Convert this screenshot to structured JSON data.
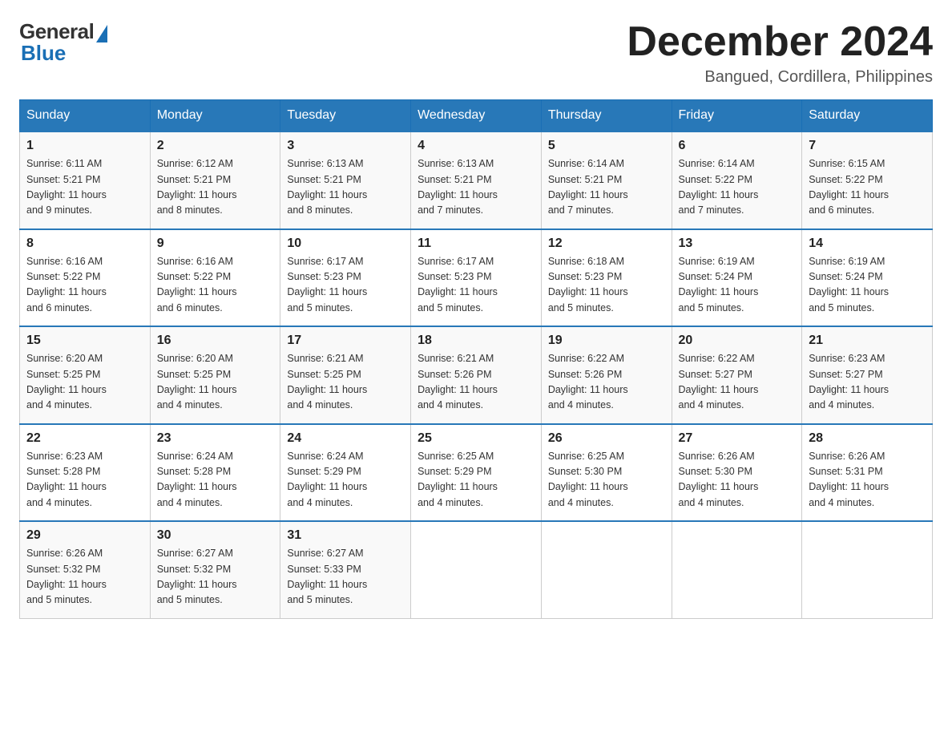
{
  "header": {
    "logo_general": "General",
    "logo_blue": "Blue",
    "month_title": "December 2024",
    "location": "Bangued, Cordillera, Philippines"
  },
  "weekdays": [
    "Sunday",
    "Monday",
    "Tuesday",
    "Wednesday",
    "Thursday",
    "Friday",
    "Saturday"
  ],
  "weeks": [
    [
      {
        "day": "1",
        "sunrise": "6:11 AM",
        "sunset": "5:21 PM",
        "daylight": "11 hours and 9 minutes."
      },
      {
        "day": "2",
        "sunrise": "6:12 AM",
        "sunset": "5:21 PM",
        "daylight": "11 hours and 8 minutes."
      },
      {
        "day": "3",
        "sunrise": "6:13 AM",
        "sunset": "5:21 PM",
        "daylight": "11 hours and 8 minutes."
      },
      {
        "day": "4",
        "sunrise": "6:13 AM",
        "sunset": "5:21 PM",
        "daylight": "11 hours and 7 minutes."
      },
      {
        "day": "5",
        "sunrise": "6:14 AM",
        "sunset": "5:21 PM",
        "daylight": "11 hours and 7 minutes."
      },
      {
        "day": "6",
        "sunrise": "6:14 AM",
        "sunset": "5:22 PM",
        "daylight": "11 hours and 7 minutes."
      },
      {
        "day": "7",
        "sunrise": "6:15 AM",
        "sunset": "5:22 PM",
        "daylight": "11 hours and 6 minutes."
      }
    ],
    [
      {
        "day": "8",
        "sunrise": "6:16 AM",
        "sunset": "5:22 PM",
        "daylight": "11 hours and 6 minutes."
      },
      {
        "day": "9",
        "sunrise": "6:16 AM",
        "sunset": "5:22 PM",
        "daylight": "11 hours and 6 minutes."
      },
      {
        "day": "10",
        "sunrise": "6:17 AM",
        "sunset": "5:23 PM",
        "daylight": "11 hours and 5 minutes."
      },
      {
        "day": "11",
        "sunrise": "6:17 AM",
        "sunset": "5:23 PM",
        "daylight": "11 hours and 5 minutes."
      },
      {
        "day": "12",
        "sunrise": "6:18 AM",
        "sunset": "5:23 PM",
        "daylight": "11 hours and 5 minutes."
      },
      {
        "day": "13",
        "sunrise": "6:19 AM",
        "sunset": "5:24 PM",
        "daylight": "11 hours and 5 minutes."
      },
      {
        "day": "14",
        "sunrise": "6:19 AM",
        "sunset": "5:24 PM",
        "daylight": "11 hours and 5 minutes."
      }
    ],
    [
      {
        "day": "15",
        "sunrise": "6:20 AM",
        "sunset": "5:25 PM",
        "daylight": "11 hours and 4 minutes."
      },
      {
        "day": "16",
        "sunrise": "6:20 AM",
        "sunset": "5:25 PM",
        "daylight": "11 hours and 4 minutes."
      },
      {
        "day": "17",
        "sunrise": "6:21 AM",
        "sunset": "5:25 PM",
        "daylight": "11 hours and 4 minutes."
      },
      {
        "day": "18",
        "sunrise": "6:21 AM",
        "sunset": "5:26 PM",
        "daylight": "11 hours and 4 minutes."
      },
      {
        "day": "19",
        "sunrise": "6:22 AM",
        "sunset": "5:26 PM",
        "daylight": "11 hours and 4 minutes."
      },
      {
        "day": "20",
        "sunrise": "6:22 AM",
        "sunset": "5:27 PM",
        "daylight": "11 hours and 4 minutes."
      },
      {
        "day": "21",
        "sunrise": "6:23 AM",
        "sunset": "5:27 PM",
        "daylight": "11 hours and 4 minutes."
      }
    ],
    [
      {
        "day": "22",
        "sunrise": "6:23 AM",
        "sunset": "5:28 PM",
        "daylight": "11 hours and 4 minutes."
      },
      {
        "day": "23",
        "sunrise": "6:24 AM",
        "sunset": "5:28 PM",
        "daylight": "11 hours and 4 minutes."
      },
      {
        "day": "24",
        "sunrise": "6:24 AM",
        "sunset": "5:29 PM",
        "daylight": "11 hours and 4 minutes."
      },
      {
        "day": "25",
        "sunrise": "6:25 AM",
        "sunset": "5:29 PM",
        "daylight": "11 hours and 4 minutes."
      },
      {
        "day": "26",
        "sunrise": "6:25 AM",
        "sunset": "5:30 PM",
        "daylight": "11 hours and 4 minutes."
      },
      {
        "day": "27",
        "sunrise": "6:26 AM",
        "sunset": "5:30 PM",
        "daylight": "11 hours and 4 minutes."
      },
      {
        "day": "28",
        "sunrise": "6:26 AM",
        "sunset": "5:31 PM",
        "daylight": "11 hours and 4 minutes."
      }
    ],
    [
      {
        "day": "29",
        "sunrise": "6:26 AM",
        "sunset": "5:32 PM",
        "daylight": "11 hours and 5 minutes."
      },
      {
        "day": "30",
        "sunrise": "6:27 AM",
        "sunset": "5:32 PM",
        "daylight": "11 hours and 5 minutes."
      },
      {
        "day": "31",
        "sunrise": "6:27 AM",
        "sunset": "5:33 PM",
        "daylight": "11 hours and 5 minutes."
      },
      null,
      null,
      null,
      null
    ]
  ],
  "labels": {
    "sunrise": "Sunrise:",
    "sunset": "Sunset:",
    "daylight": "Daylight:"
  }
}
